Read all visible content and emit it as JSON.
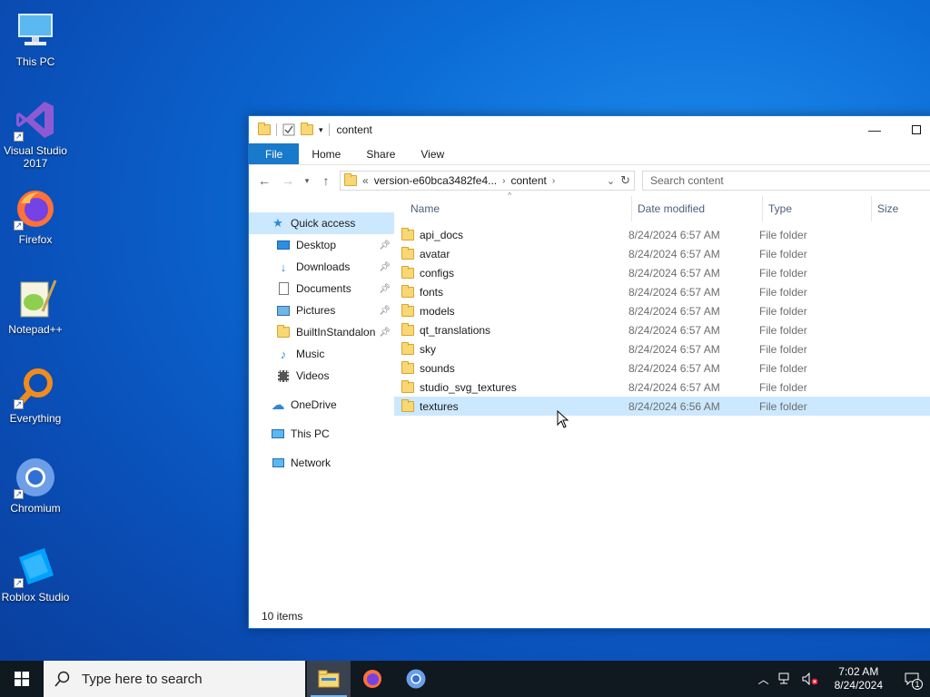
{
  "desktop": {
    "icons": [
      {
        "label": "This PC"
      },
      {
        "label": "Visual Studio 2017"
      },
      {
        "label": "Firefox"
      },
      {
        "label": "Notepad++"
      },
      {
        "label": "Everything"
      },
      {
        "label": "Chromium"
      },
      {
        "label": "Roblox Studio"
      }
    ]
  },
  "explorer": {
    "title": "content",
    "ribbon_tabs": [
      "File",
      "Home",
      "Share",
      "View"
    ],
    "address": {
      "overflow": "«",
      "crumbs": [
        "version-e60bca3482fe4...",
        "content"
      ]
    },
    "search_placeholder": "Search content",
    "nav": {
      "quick_access": "Quick access",
      "pinned": [
        {
          "label": "Desktop",
          "icon": "desktop-icon",
          "pinned": true
        },
        {
          "label": "Downloads",
          "icon": "download-arrow-icon",
          "pinned": true
        },
        {
          "label": "Documents",
          "icon": "documents-icon",
          "pinned": true
        },
        {
          "label": "Pictures",
          "icon": "pictures-icon",
          "pinned": true
        },
        {
          "label": "BuiltInStandalon",
          "icon": "folder-icon",
          "pinned": true
        },
        {
          "label": "Music",
          "icon": "music-note-icon",
          "pinned": false
        },
        {
          "label": "Videos",
          "icon": "videos-icon",
          "pinned": false
        }
      ],
      "onedrive": "OneDrive",
      "this_pc": "This PC",
      "network": "Network"
    },
    "columns": {
      "name": "Name",
      "date": "Date modified",
      "type": "Type",
      "size": "Size"
    },
    "files": [
      {
        "name": "api_docs",
        "date": "8/24/2024 6:57 AM",
        "type": "File folder"
      },
      {
        "name": "avatar",
        "date": "8/24/2024 6:57 AM",
        "type": "File folder"
      },
      {
        "name": "configs",
        "date": "8/24/2024 6:57 AM",
        "type": "File folder"
      },
      {
        "name": "fonts",
        "date": "8/24/2024 6:57 AM",
        "type": "File folder"
      },
      {
        "name": "models",
        "date": "8/24/2024 6:57 AM",
        "type": "File folder"
      },
      {
        "name": "qt_translations",
        "date": "8/24/2024 6:57 AM",
        "type": "File folder"
      },
      {
        "name": "sky",
        "date": "8/24/2024 6:57 AM",
        "type": "File folder"
      },
      {
        "name": "sounds",
        "date": "8/24/2024 6:57 AM",
        "type": "File folder"
      },
      {
        "name": "studio_svg_textures",
        "date": "8/24/2024 6:57 AM",
        "type": "File folder"
      },
      {
        "name": "textures",
        "date": "8/24/2024 6:56 AM",
        "type": "File folder",
        "selected": true
      }
    ],
    "status": "10 items"
  },
  "taskbar": {
    "search_placeholder": "Type here to search",
    "time": "7:02 AM",
    "date": "8/24/2024",
    "notification_count": "1"
  },
  "colors": {
    "accent": "#1979ca",
    "selection": "#cce8ff",
    "taskbar": "#101820"
  }
}
